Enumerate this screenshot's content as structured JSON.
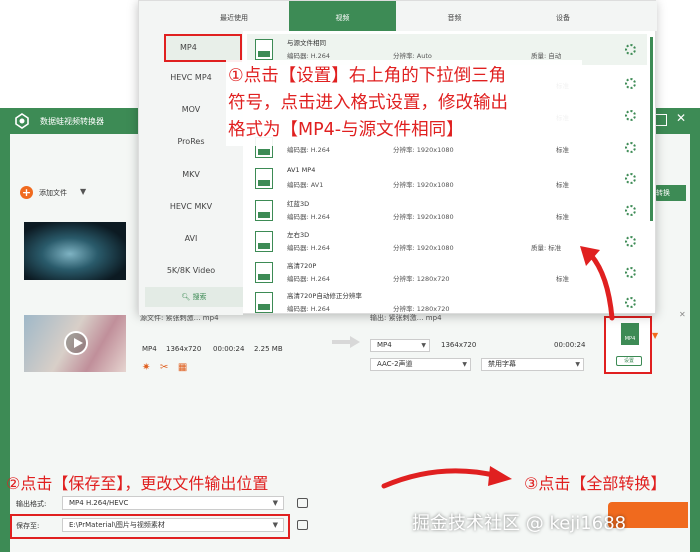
{
  "app": {
    "title": "数据蛙视频转换器"
  },
  "toolbar": {
    "add_label": "添加文件",
    "convert_partial": "转换"
  },
  "files": [
    {
      "src_name": "源文件:  紧张刺激… mp4",
      "format": "MP4",
      "resolution": "1364x720",
      "duration": "00:00:24",
      "size": "2.25 MB",
      "out_name": "输出:  紧张刺激… mp4",
      "out_format": "MP4",
      "out_resolution": "1364x720",
      "out_duration": "00:00:24",
      "audio": "AAC-2声道",
      "subtitle": "禁用字幕"
    }
  ],
  "format_badge": {
    "label": "MP4",
    "setting": "设置"
  },
  "popup": {
    "tabs": [
      "最近使用",
      "视频",
      "音频",
      "设备"
    ],
    "active_tab": 1,
    "categories": [
      "MP4",
      "HEVC MP4",
      "MOV",
      "ProRes",
      "MKV",
      "HEVC MKV",
      "AVI",
      "5K/8K Video"
    ],
    "search_label": "搜索",
    "formats": [
      {
        "name": "与源文件相同",
        "codec": "编码器:  H.264",
        "res": "分辨率:  Auto",
        "quality": "质量:  自动",
        "icon": "SAME"
      },
      {
        "name": "",
        "codec": "",
        "res": "",
        "quality": "标准",
        "icon": "4K"
      },
      {
        "name": "",
        "codec": "",
        "res": "",
        "quality": "标准",
        "icon": "HD"
      },
      {
        "name": "",
        "codec": "编码器:  H.264",
        "res": "分辨率:  1920x1080",
        "quality": "标准",
        "icon": "1080P"
      },
      {
        "name": "AV1 MP4",
        "codec": "编码器:  AV1",
        "res": "分辨率:  1920x1080",
        "quality": "标准",
        "icon": "1080P"
      },
      {
        "name": "红蓝3D",
        "codec": "编码器:  H.264",
        "res": "分辨率:  1920x1080",
        "quality": "标准",
        "icon": "3D"
      },
      {
        "name": "左右3D",
        "codec": "编码器:  H.264",
        "res": "分辨率:  1920x1080",
        "quality": "质量:  标准",
        "icon": "3D"
      },
      {
        "name": "高清720P",
        "codec": "编码器:  H.264",
        "res": "分辨率:  1280x720",
        "quality": "标准",
        "icon": "720P"
      },
      {
        "name": "高清720P自动修正分辨率",
        "codec": "编码器:  H.264",
        "res": "分辨率:  1280x720",
        "quality": "",
        "icon": "720P"
      }
    ]
  },
  "callouts": {
    "step1": [
      "①点击【设置】右上角的下拉倒三角",
      "符号，点击进入格式设置，修改输出",
      "格式为【MP4-与源文件相同】"
    ],
    "step2": "②点击【保存至】，更改文件输出位置",
    "step3": "③点击【全部转换】"
  },
  "bottom": {
    "output_label": "输出格式:",
    "output_value": "MP4 H.264/HEVC",
    "save_label": "保存至:",
    "save_path": "E:\\PrMaterial\\图片与视频素材"
  },
  "watermark": "掘金技术社区 @ keji1688",
  "colors": {
    "brand_green": "#3d8b55",
    "accent_orange": "#f06a1e",
    "annotation_red": "#e02020"
  }
}
